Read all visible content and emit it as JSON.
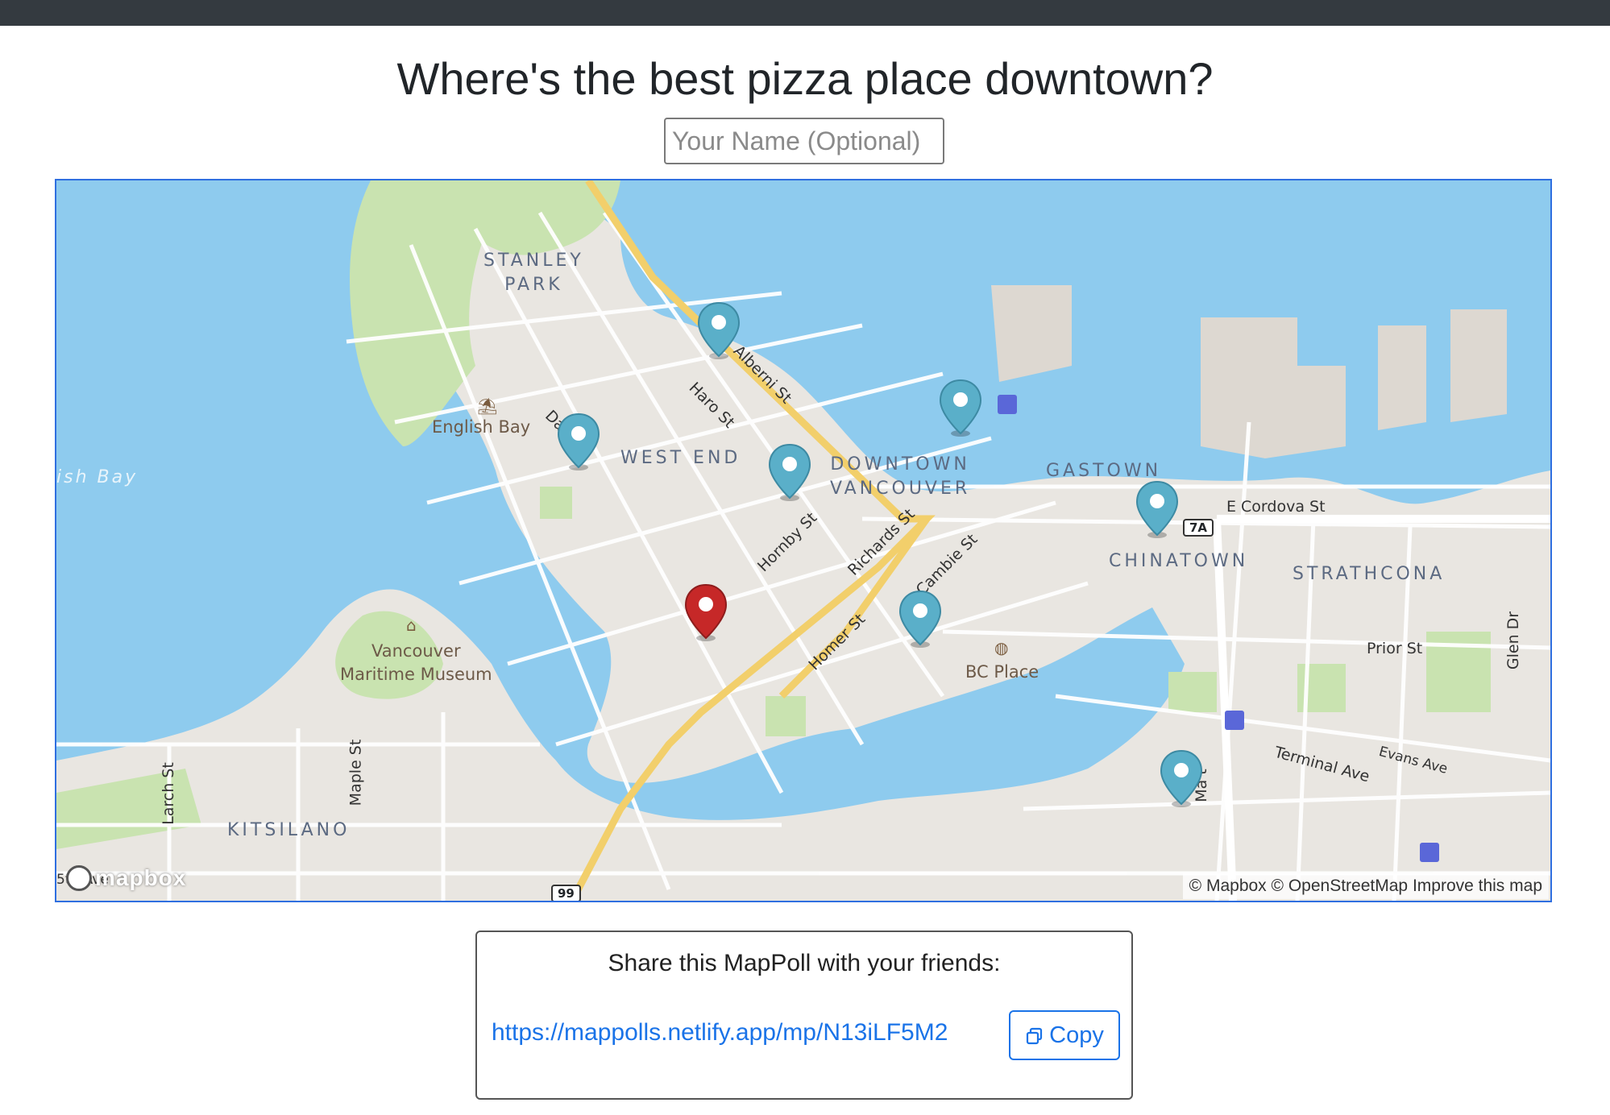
{
  "title": "Where's the best pizza place downtown?",
  "name_input": {
    "placeholder": "Your Name (Optional)",
    "value": ""
  },
  "map": {
    "area_labels": {
      "stanley_park": "STANLEY\nPARK",
      "west_end": "WEST END",
      "downtown": "DOWNTOWN\nVANCOUVER",
      "gastown": "GASTOWN",
      "chinatown": "CHINATOWN",
      "strathcona": "STRATHCONA",
      "kitsilano": "KITSILANO"
    },
    "water_labels": {
      "english_bay_partial": "ish Bay"
    },
    "poi_labels": {
      "english_bay": "English Bay",
      "maritime_museum": "Vancouver\nMaritime Museum",
      "bc_place": "BC Place"
    },
    "street_labels": {
      "alberni": "Alberni St",
      "haro": "Haro St",
      "davie": "Da    t",
      "hornby": "Hornby St",
      "richards": "Richards St",
      "cambie": "Cambie St",
      "homer": "Homer St",
      "e_cordova": "E Cordova St",
      "prior": "Prior St",
      "glen": "Glen Dr",
      "terminal": "Terminal Ave",
      "evans": "Evans Ave",
      "main": "Ma   t",
      "larch": "Larch St",
      "maple": "Maple St",
      "fifth": "5th Ave"
    },
    "route_shields": {
      "r7a": "7A",
      "r99": "99"
    },
    "pin_colors": {
      "vote": "#5aafc9",
      "selected": "#c62828"
    },
    "attribution": {
      "mapbox": "© Mapbox",
      "osm": "© OpenStreetMap",
      "improve": "Improve this map"
    },
    "logo_text": "mapbox"
  },
  "share": {
    "heading": "Share this MapPoll with your friends:",
    "link": "https://mappolls.netlify.app/mp/N13iLF5M2",
    "copy_label": "Copy"
  }
}
